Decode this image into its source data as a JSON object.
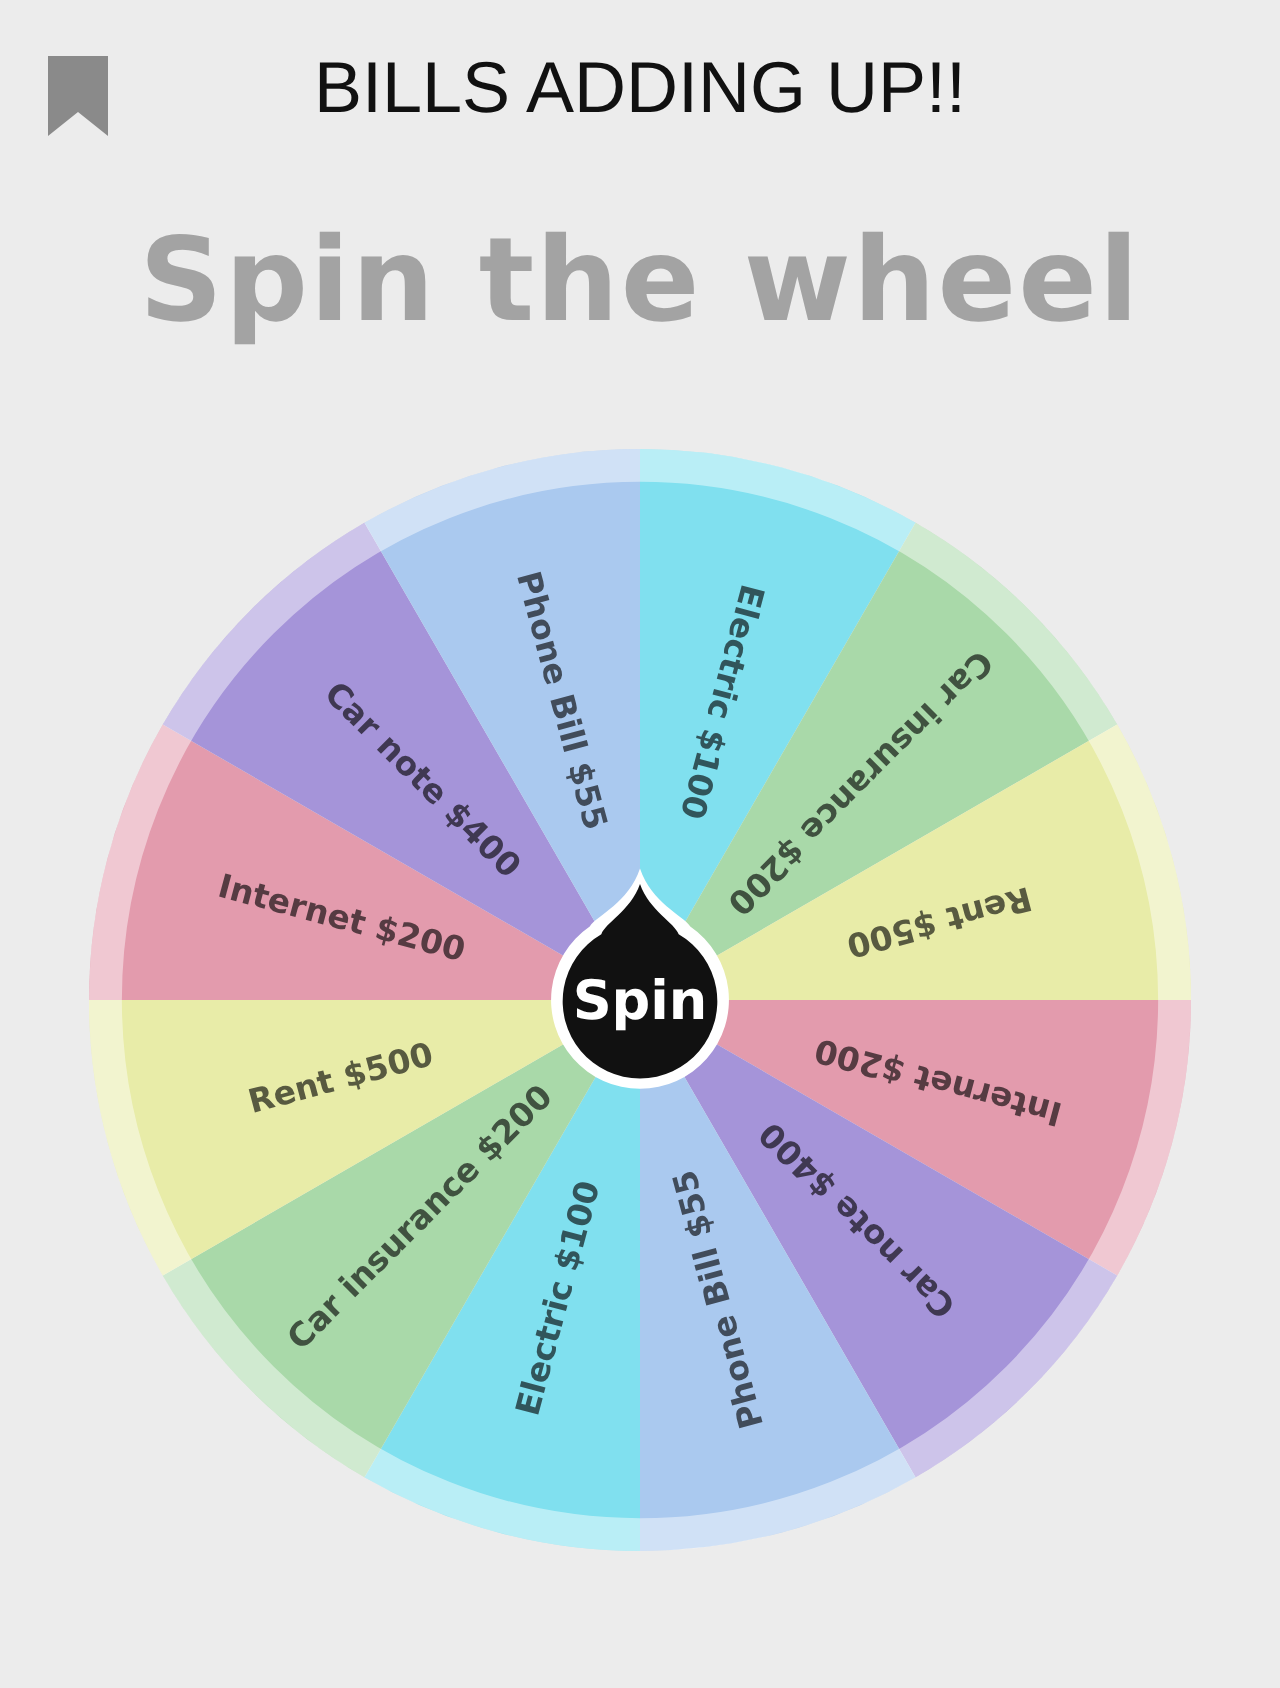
{
  "title": "BILLS ADDING UP!!",
  "heading": "Spin the wheel",
  "wheel": {
    "segments": [
      {
        "label": "Electric $100",
        "color": "#80e0ef"
      },
      {
        "label": "Car insurance $200",
        "color": "#a9d9a9"
      },
      {
        "label": "Rent $500",
        "color": "#e8eca8"
      },
      {
        "label": "Internet $200",
        "color": "#e39bad"
      },
      {
        "label": "Car note $400",
        "color": "#a594d9"
      },
      {
        "label": "Phone Bill $55",
        "color": "#aac9ef"
      },
      {
        "label": "Electric $100",
        "color": "#80e0ef"
      },
      {
        "label": "Car insurance $200",
        "color": "#a9d9a9"
      },
      {
        "label": "Rent $500",
        "color": "#e8eca8"
      },
      {
        "label": "Internet $200",
        "color": "#e39bad"
      },
      {
        "label": "Car note $400",
        "color": "#a594d9"
      },
      {
        "label": "Phone Bill $55",
        "color": "#aac9ef"
      }
    ]
  },
  "spin_button": "Spin"
}
